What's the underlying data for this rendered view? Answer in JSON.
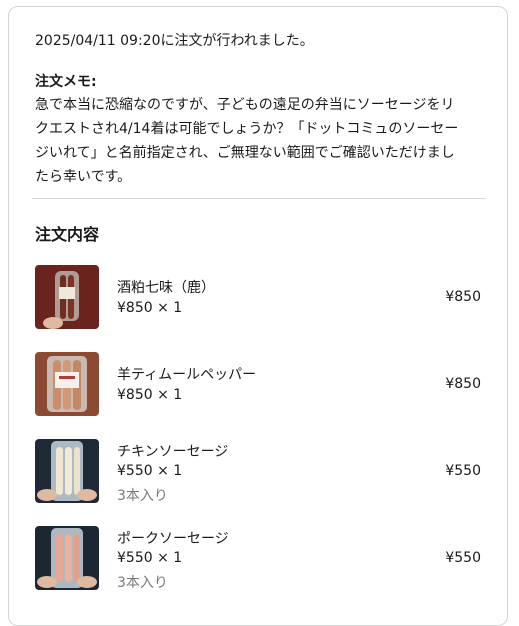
{
  "order": {
    "placed_text": "2025/04/11 09:20に注文が行われました。",
    "memo_title": "注文メモ:",
    "memo_lines": [
      "急で本当に恐縮なのですが、子どもの遠足の弁当にソーセージをリ",
      "クエストされ4/14着は可能でしょうか？「ドットコミュのソーセー",
      "ジいれて」と名前指定され、ご無理ない範囲でご確認いただけまし",
      "たら幸いです。"
    ]
  },
  "contents": {
    "title": "注文内容",
    "items": [
      {
        "name": "酒粕七味（鹿）",
        "qty": "¥850 × 1",
        "note": "",
        "price": "¥850"
      },
      {
        "name": "羊ティムールペッパー",
        "qty": "¥850 × 1",
        "note": "",
        "price": "¥850"
      },
      {
        "name": "チキンソーセージ",
        "qty": "¥550 × 1",
        "note": "3本入り",
        "price": "¥550"
      },
      {
        "name": "ポークソーセージ",
        "qty": "¥550 × 1",
        "note": "3本入り",
        "price": "¥550"
      }
    ]
  }
}
